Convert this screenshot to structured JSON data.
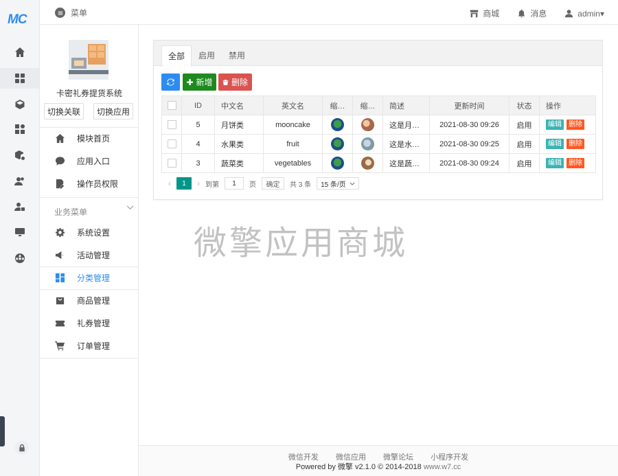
{
  "brand": {
    "logo_text": "MC"
  },
  "topbar": {
    "menu_label": "菜单",
    "shop_label": "商城",
    "message_label": "消息",
    "user_label": "admin▾"
  },
  "sidebar": {
    "app_name": "卡密礼券提货系统",
    "switch_link_btn": "切换关联",
    "switch_app_btn": "切换应用",
    "items": [
      {
        "label": "模块首页",
        "icon": "home-icon"
      },
      {
        "label": "应用入口",
        "icon": "chat-bubble-icon"
      },
      {
        "label": "操作员权限",
        "icon": "document-edit-icon"
      }
    ],
    "group_label": "业务菜单",
    "business_items": [
      {
        "label": "系统设置",
        "icon": "gear-icon"
      },
      {
        "label": "活动管理",
        "icon": "megaphone-icon"
      },
      {
        "label": "分类管理",
        "icon": "grid-layout-icon",
        "active": true
      },
      {
        "label": "商品管理",
        "icon": "shopping-bag-icon"
      },
      {
        "label": "礼券管理",
        "icon": "ticket-icon"
      },
      {
        "label": "订单管理",
        "icon": "cart-icon"
      }
    ]
  },
  "tabs": [
    "全部",
    "启用",
    "禁用"
  ],
  "toolbar": {
    "add_label": "新增",
    "delete_label": "删除"
  },
  "table": {
    "headers": [
      "ID",
      "中文名",
      "英文名",
      "缩…",
      "缩…",
      "简述",
      "更新时间",
      "状态",
      "操作"
    ],
    "rows": [
      {
        "id": "5",
        "cn": "月饼类",
        "en": "mooncake",
        "desc": "这是月…",
        "time": "2021-08-30 09:26",
        "status": "启用",
        "edit": "编辑",
        "del": "删除"
      },
      {
        "id": "4",
        "cn": "水果类",
        "en": "fruit",
        "desc": "这是水…",
        "time": "2021-08-30 09:25",
        "status": "启用",
        "edit": "编辑",
        "del": "删除"
      },
      {
        "id": "3",
        "cn": "蔬菜类",
        "en": "vegetables",
        "desc": "这是蔬…",
        "time": "2021-08-30 09:24",
        "status": "启用",
        "edit": "编辑",
        "del": "删除"
      }
    ]
  },
  "pager": {
    "current": "1",
    "goto_prefix": "到第",
    "goto_value": "1",
    "goto_suffix": "页",
    "confirm": "确定",
    "total": "共 3 条",
    "page_size": "15 条/页"
  },
  "watermark": "微擎应用商城",
  "footer": {
    "links": [
      "微信开发",
      "微信应用",
      "微擎论坛",
      "小程序开发"
    ],
    "copyright": "Powered by 微擎 v2.1.0 © 2014-2018",
    "domain": "www.w7.cc"
  },
  "colors": {
    "primary": "#2d8cf0",
    "add": "#1e8a1e",
    "delete": "#d9534f",
    "pager_active": "#009688",
    "edit_tag": "#39b3b3",
    "remove_tag": "#ff5722"
  }
}
